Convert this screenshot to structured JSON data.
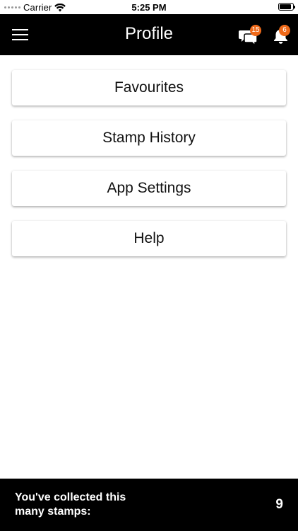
{
  "status_bar": {
    "carrier": "Carrier",
    "time": "5:25 PM"
  },
  "header": {
    "title": "Profile",
    "menu_icon": "hamburger-menu-icon",
    "messages_icon": "chat-bubbles-icon",
    "messages_badge": "15",
    "notifications_icon": "bell-icon",
    "notifications_badge": "6",
    "badge_color": "#ef6a1a"
  },
  "menu": {
    "items": [
      {
        "label": "Favourites"
      },
      {
        "label": "Stamp History"
      },
      {
        "label": "App Settings"
      },
      {
        "label": "Help"
      }
    ]
  },
  "footer": {
    "label": "You've collected this many stamps:",
    "count": "9"
  }
}
